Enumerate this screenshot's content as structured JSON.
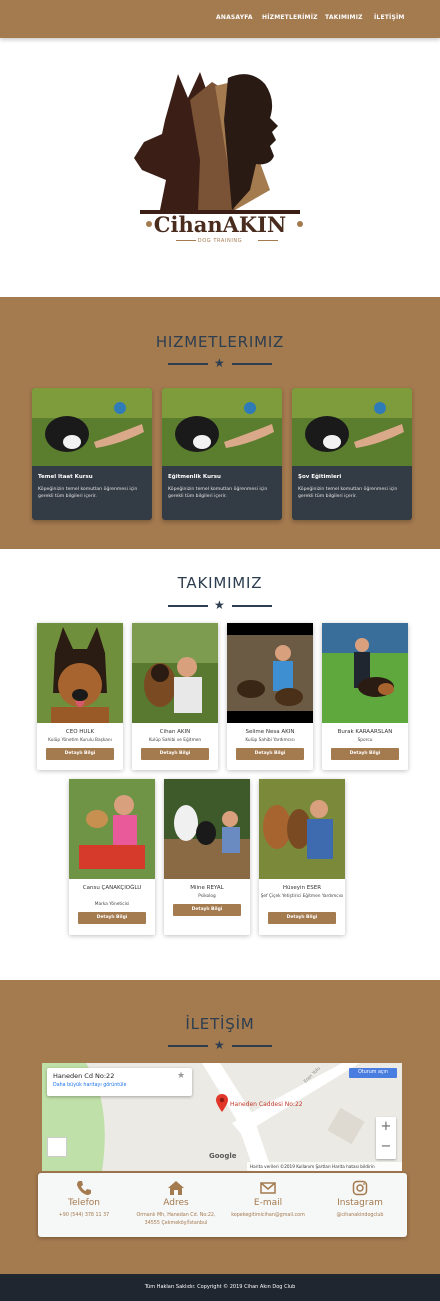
{
  "nav": {
    "items": [
      {
        "label": "ANASAYFA",
        "name": "nav-anasayfa"
      },
      {
        "label": "HİZMETLERİMİZ",
        "name": "nav-hizmetlerimiz"
      },
      {
        "label": "TAKIMIMIZ",
        "name": "nav-takimimiz"
      },
      {
        "label": "İLETİŞİM",
        "name": "nav-iletisim"
      }
    ]
  },
  "logo": {
    "title": "CihanAKIN",
    "subtitle": "DOG TRAINING"
  },
  "services": {
    "title": "HIZMETLERIMIZ",
    "cards": [
      {
        "title": "Temel Itaat Kursu",
        "desc": "Köpeğinizin temel komutları öğrenmesi için gerekli tüm bilgileri içerir."
      },
      {
        "title": "Eğitmenlik Kursu",
        "desc": "Köpeğinizin temel komutları öğrenmesi için gerekli tüm bilgileri içerir."
      },
      {
        "title": "Şov Eğitimleri",
        "desc": "Köpeğinizin temel komutları öğrenmesi için gerekli tüm bilgileri içerir."
      }
    ]
  },
  "team": {
    "title": "TAKIMIMIZ",
    "button_label": "Detaylı Bilgi",
    "members": [
      {
        "name": "CEO HULK",
        "role": "Kulüp Yönetim Kurulu Başkanı"
      },
      {
        "name": "Cihan AKIN",
        "role": "Kulüp Sahibi ve Eğitmen"
      },
      {
        "name": "Selime Nesa AKIN",
        "role": "Kulüp Sahibi Yardımcısı"
      },
      {
        "name": "Burak KARAARSLAN",
        "role": "Sporcu"
      },
      {
        "name": "Cansu ÇANAKÇIOĞLU",
        "role": "Marka Yöneticisi"
      },
      {
        "name": "Miine REYAL",
        "role": "Psikolog"
      },
      {
        "name": "Hüseyin ESER",
        "role": "Şef Çiçek Yetiştirici Eğitmen Yardımcısı"
      }
    ]
  },
  "contact_section": {
    "title": "İLETİŞİM",
    "map": {
      "place_name": "Haneden Cd No:22",
      "map_link": "Daha büyük haritayı görüntüle",
      "pin_label": "Haneden Caddesi No:22",
      "open_button": "Oturum açın",
      "attribution": "Harita verileri ©2019   Kullanım Şartları   Harita hatası bildirin",
      "logo_text": "Google",
      "street_label": "Eren Yolu"
    },
    "items": [
      {
        "label": "Telefon",
        "value": "+90 (544) 378 11 37",
        "icon": "phone-icon"
      },
      {
        "label": "Adres",
        "value": "Ormanlı Mh, Hanedan Cd. No:22, 34555 Çekmeköy/İstanbul",
        "icon": "home-icon"
      },
      {
        "label": "E-mail",
        "value": "kopekegitimicihan@gmail.com",
        "icon": "envelope-icon"
      },
      {
        "label": "Instagram",
        "value": "@cihanakindogclub",
        "icon": "instagram-icon"
      }
    ]
  },
  "footer": {
    "text": "Tüm Hakları Saklıdır. Copyright © 2019 Cihan Akın Dog Club"
  },
  "colors": {
    "brand": "#a47a4f",
    "dark": "#2c3e50",
    "footer": "#1f2630",
    "card": "#333b44"
  }
}
